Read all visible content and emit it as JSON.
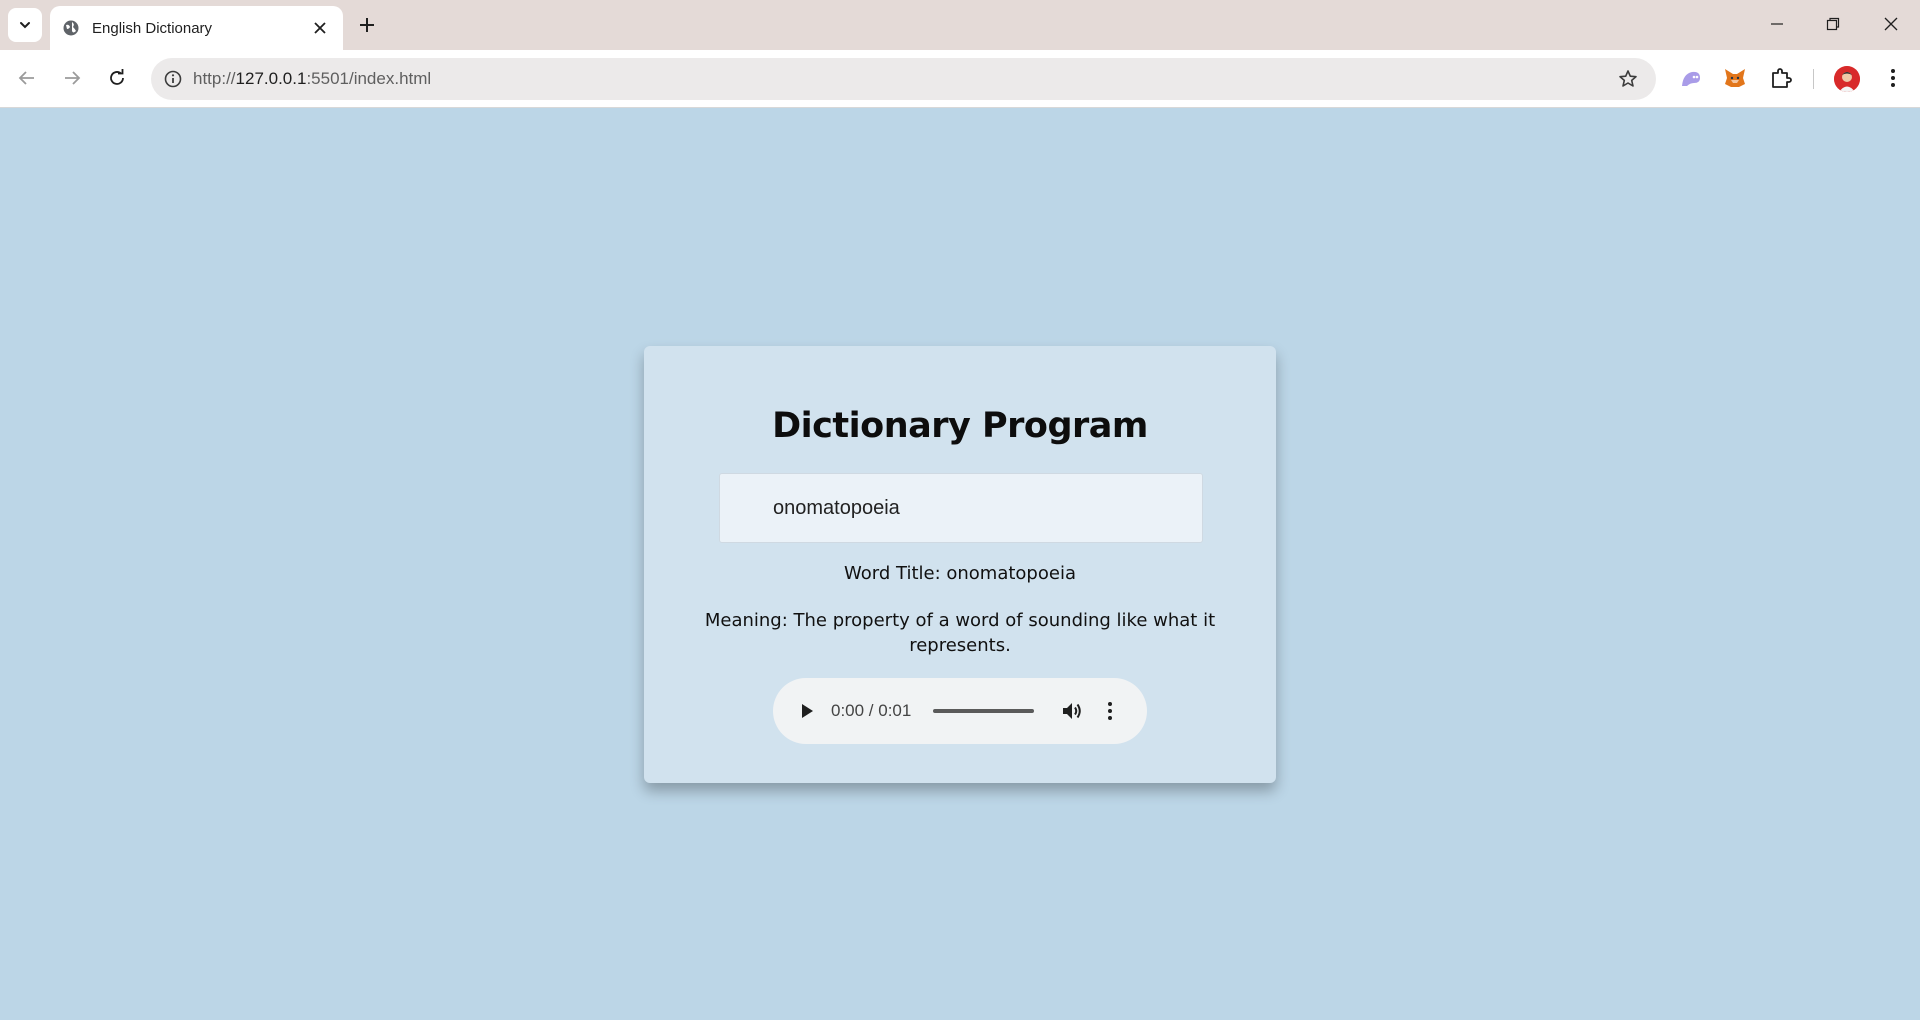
{
  "browser": {
    "tab_title": "English Dictionary",
    "url_prefix": "http://",
    "url_host": "127.0.0.1",
    "url_path": ":5501/index.html"
  },
  "page": {
    "title": "Dictionary Program",
    "search_value": "onomatopoeia",
    "word_title": "Word Title: onomatopoeia",
    "meaning": "Meaning: The property of a word of sounding like what it represents.",
    "audio": {
      "time": "0:00 / 0:01",
      "progress": 0
    }
  },
  "colors": {
    "page_background": "#bcd6e7",
    "card_background": "#d1e2ee",
    "tabbar_background": "#e4dad7"
  }
}
